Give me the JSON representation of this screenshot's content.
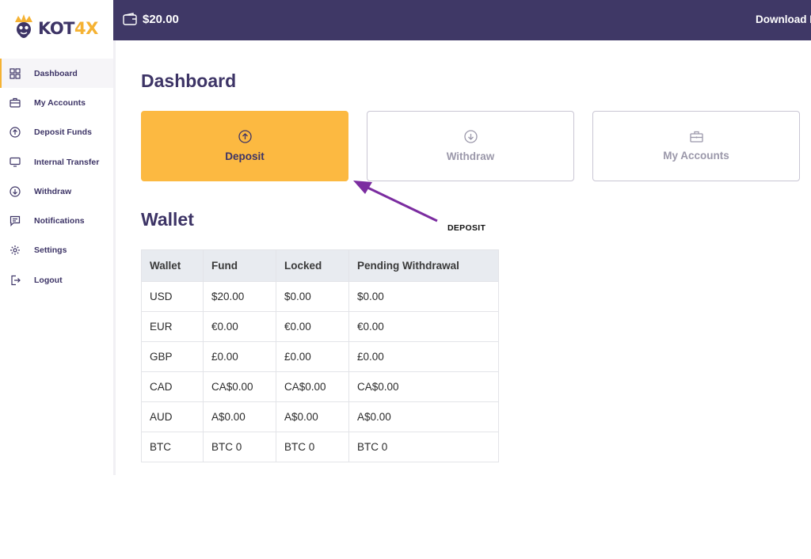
{
  "brand": {
    "logo_text_main": "KOT",
    "logo_text_accent": "4X",
    "accent_color": "#f5b233",
    "primary_color": "#3f3866"
  },
  "sidebar": {
    "items": [
      {
        "label": "Dashboard",
        "icon": "dashboard-grid-icon",
        "active": true
      },
      {
        "label": "My Accounts",
        "icon": "briefcase-icon"
      },
      {
        "label": "Deposit Funds",
        "icon": "arrow-up-circle-icon"
      },
      {
        "label": "Internal Transfer",
        "icon": "monitor-icon"
      },
      {
        "label": "Withdraw",
        "icon": "arrow-down-circle-icon"
      },
      {
        "label": "Notifications",
        "icon": "message-icon"
      },
      {
        "label": "Settings",
        "icon": "gear-icon"
      },
      {
        "label": "Logout",
        "icon": "logout-icon"
      }
    ]
  },
  "topbar": {
    "balance": "$20.00",
    "download_label": "Download M"
  },
  "main": {
    "title": "Dashboard",
    "cards": [
      {
        "label": "Deposit",
        "icon": "arrow-up-circle-icon"
      },
      {
        "label": "Withdraw",
        "icon": "arrow-down-circle-icon"
      },
      {
        "label": "My Accounts",
        "icon": "briefcase-icon"
      }
    ],
    "annotation": "DEPOSIT",
    "wallet_title": "Wallet",
    "table": {
      "headers": [
        "Wallet",
        "Fund",
        "Locked",
        "Pending Withdrawal"
      ],
      "rows": [
        [
          "USD",
          "$20.00",
          "$0.00",
          "$0.00"
        ],
        [
          "EUR",
          "€0.00",
          "€0.00",
          "€0.00"
        ],
        [
          "GBP",
          "£0.00",
          "£0.00",
          "£0.00"
        ],
        [
          "CAD",
          "CA$0.00",
          "CA$0.00",
          "CA$0.00"
        ],
        [
          "AUD",
          "A$0.00",
          "A$0.00",
          "A$0.00"
        ],
        [
          "BTC",
          "BTC 0",
          "BTC 0",
          "BTC 0"
        ]
      ]
    }
  }
}
